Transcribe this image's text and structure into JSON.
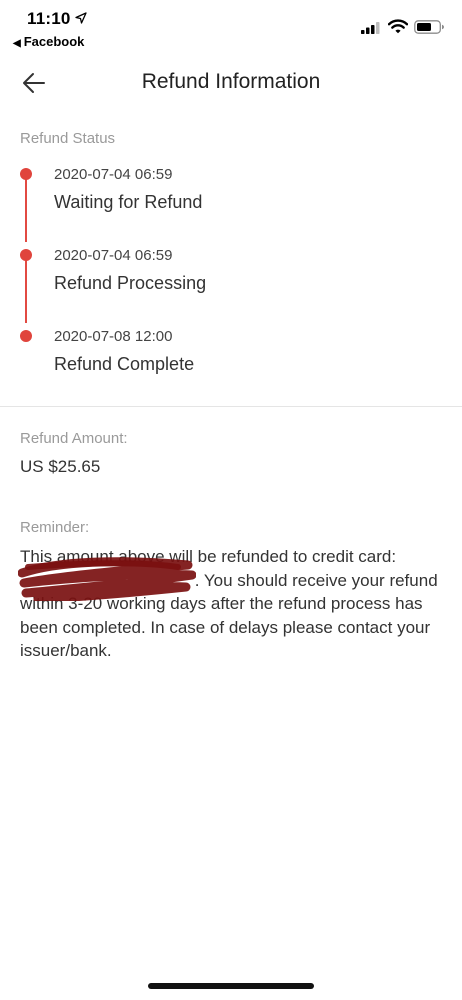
{
  "status_bar": {
    "time": "11:10",
    "back_app": "Facebook",
    "icons": [
      "location-arrow-icon",
      "cellular-signal-icon",
      "wifi-icon",
      "battery-icon"
    ]
  },
  "header": {
    "title": "Refund Information",
    "back_icon": "back-arrow-icon"
  },
  "refund_status": {
    "label": "Refund Status",
    "steps": [
      {
        "date": "2020-07-04 06:59",
        "text": "Waiting for Refund"
      },
      {
        "date": "2020-07-04 06:59",
        "text": "Refund Processing"
      },
      {
        "date": "2020-07-08 12:00",
        "text": "Refund Complete"
      }
    ]
  },
  "refund_amount": {
    "label": "Refund Amount:",
    "value": "US $25.65"
  },
  "reminder": {
    "label": "Reminder:",
    "text": "This amount above will be refunded to credit card:                                      . You should receive your refund within 3-20 working days after the refund process has been completed. In case of delays please contact your issuer/bank."
  },
  "colors": {
    "accent": "#e0443c",
    "redaction": "#7a1010",
    "muted_text": "#9a9a9a"
  }
}
